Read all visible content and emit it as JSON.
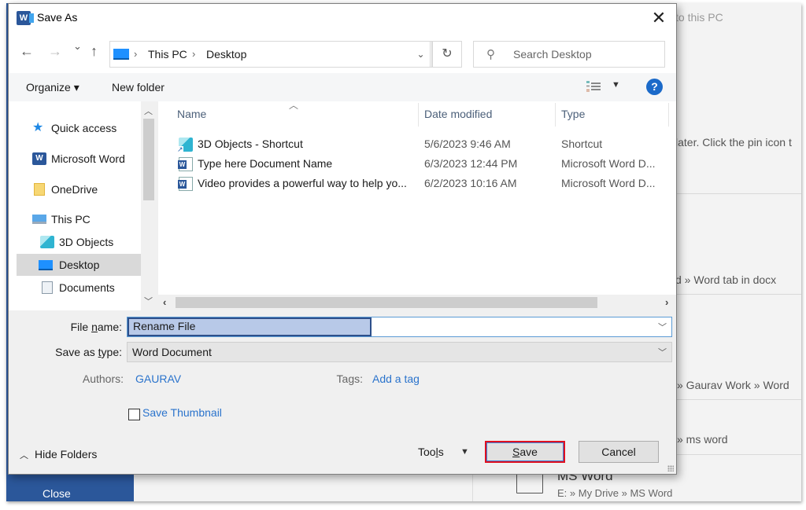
{
  "background": {
    "close_label": "Close",
    "texts": [
      {
        "text": "to this PC",
        "light": true
      },
      {
        "text": "later. Click the pin icon t",
        "light": false
      },
      {
        "text": "d » Word tab in docx",
        "light": false
      },
      {
        "text": "» Gaurav Work » Word",
        "light": false
      },
      {
        "text": "» ms word",
        "light": false
      }
    ],
    "folder_item": {
      "title": "MS Word",
      "path": "E: » My Drive » MS Word"
    }
  },
  "dialog": {
    "title": "Save As",
    "close_icon": "✕",
    "nav": {
      "back": "←",
      "forward": "→",
      "recent": "⌄",
      "up": "↑",
      "breadcrumb": [
        "This PC",
        "Desktop"
      ],
      "separator": "›",
      "dropdown": "⌄",
      "refresh": "↻",
      "search_placeholder": "Search Desktop"
    },
    "commands": {
      "organize": "Organize ▾",
      "new_folder": "New folder",
      "view_caret": "▼",
      "help": "?"
    },
    "tree": [
      {
        "label": "Quick access",
        "icon": "star-icon"
      },
      {
        "label": "Microsoft Word",
        "icon": "word-icon"
      },
      {
        "label": "OneDrive",
        "icon": "folder-icon"
      },
      {
        "label": "This PC",
        "icon": "computer-icon"
      },
      {
        "label": "3D Objects",
        "icon": "3d-objects-icon"
      },
      {
        "label": "Desktop",
        "icon": "desktop-icon",
        "selected": true
      },
      {
        "label": "Documents",
        "icon": "documents-icon"
      }
    ],
    "columns": [
      "Name",
      "Date modified",
      "Type"
    ],
    "files": [
      {
        "name": "3D Objects - Shortcut",
        "date": "5/6/2023 9:46 AM",
        "type": "Shortcut",
        "icon": "3d-shortcut-icon"
      },
      {
        "name": "Type here Document Name",
        "date": "6/3/2023 12:44 PM",
        "type": "Microsoft Word D...",
        "icon": "word-doc-icon"
      },
      {
        "name": "Video provides a powerful way to help yo...",
        "date": "6/2/2023 10:16 AM",
        "type": "Microsoft Word D...",
        "icon": "word-doc-icon"
      }
    ],
    "form": {
      "file_name_label_pre": "File ",
      "file_name_label_u": "n",
      "file_name_label_post": "ame:",
      "file_name_value": "Rename File",
      "save_type_label_pre": "Save as ",
      "save_type_label_u": "t",
      "save_type_label_post": "ype:",
      "save_type_value": "Word Document",
      "authors_label": "Authors:",
      "authors_value": "GAURAV",
      "tags_label": "Tags:",
      "tags_value": "Add a tag",
      "thumbnail_label": "Save Thumbnail",
      "thumbnail_checked": false
    },
    "footer": {
      "hide_folders": "Hide Folders",
      "tools_pre": "Too",
      "tools_u": "l",
      "tools_post": "s",
      "save_u": "S",
      "save_post": "ave",
      "cancel": "Cancel"
    }
  }
}
